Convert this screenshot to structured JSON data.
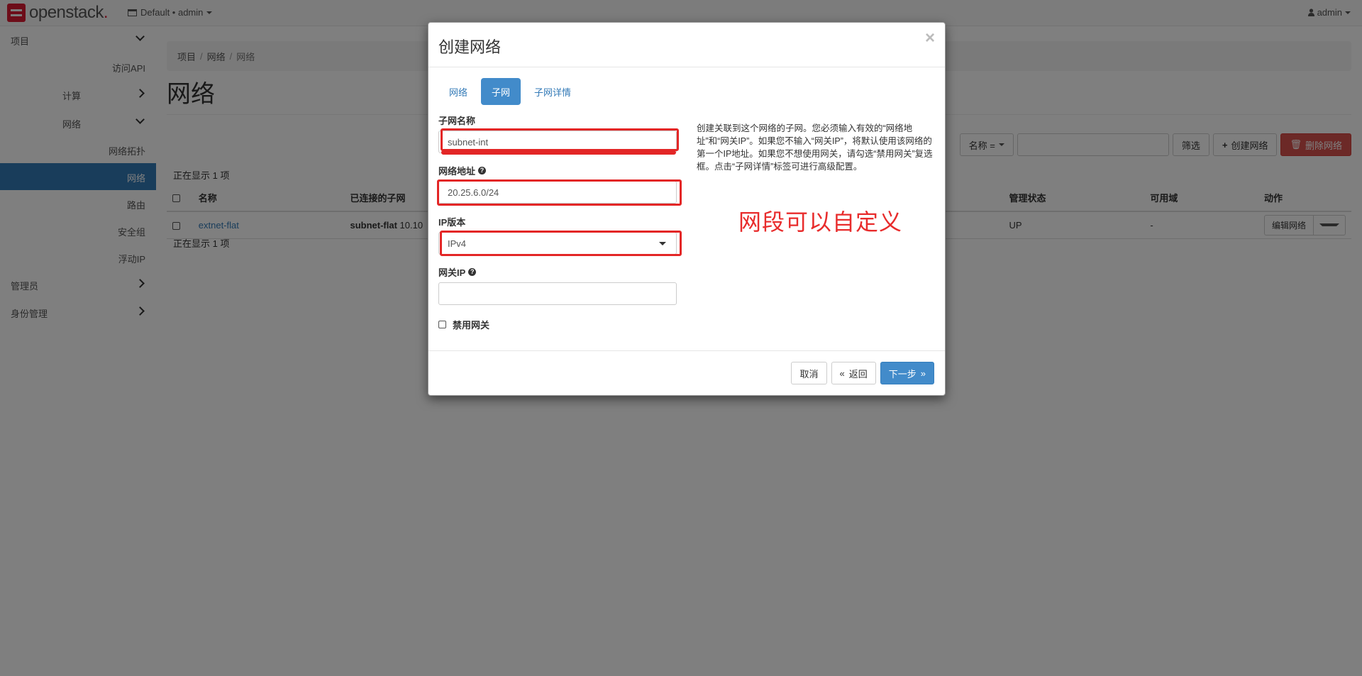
{
  "navbar": {
    "brand": "openstack",
    "brand_dot": ".",
    "project_picker": "Default • admin",
    "user": "admin"
  },
  "sidebar": {
    "project": "项目",
    "access_api": "访问API",
    "compute": "计算",
    "network": "网络",
    "network_topology": "网络拓扑",
    "networks": "网络",
    "routers": "路由",
    "security_groups": "安全组",
    "floating_ips": "浮动IP",
    "admin": "管理员",
    "identity": "身份管理"
  },
  "breadcrumb": [
    "项目",
    "网络",
    "网络"
  ],
  "page_title": "网络",
  "toolbar": {
    "name_filter": "名称 =",
    "filter_button": "筛选",
    "create_button": "创建网络",
    "delete_button": "删除网络"
  },
  "table": {
    "count_top": "正在显示 1 项",
    "count_bottom": "正在显示 1 项",
    "headers": {
      "name": "名称",
      "subnets": "已连接的子网",
      "admin_state": "管理状态",
      "az": "可用域",
      "actions": "动作"
    },
    "rows": [
      {
        "name": "extnet-flat",
        "subnet_name": "subnet-flat",
        "subnet_cidr": "10.10",
        "admin_state": "UP",
        "az": "-",
        "action": "编辑网络"
      }
    ]
  },
  "modal": {
    "title": "创建网络",
    "close": "×",
    "tabs": [
      "网络",
      "子网",
      "子网详情"
    ],
    "active_tab": "子网",
    "fields": {
      "subnet_name_label": "子网名称",
      "subnet_name_value": "subnet-int",
      "network_address_label": "网络地址",
      "network_address_value": "20.25.6.0/24",
      "ip_version_label": "IP版本",
      "ip_version_value": "IPv4",
      "gateway_ip_label": "网关IP",
      "gateway_ip_value": "",
      "disable_gateway_label": "禁用网关"
    },
    "help_text": "创建关联到这个网络的子网。您必须输入有效的“网络地址”和“网关IP”。如果您不输入“网关IP”，将默认使用该网络的第一个IP地址。如果您不想使用网关，请勾选“禁用网关”复选框。点击“子网详情”标签可进行高级配置。",
    "annotation": "网段可以自定义",
    "buttons": {
      "cancel": "取消",
      "back": "返回",
      "back_glyph": "«",
      "next": "下一步",
      "next_glyph": "»"
    },
    "annotation_color": "#e82c2c"
  }
}
